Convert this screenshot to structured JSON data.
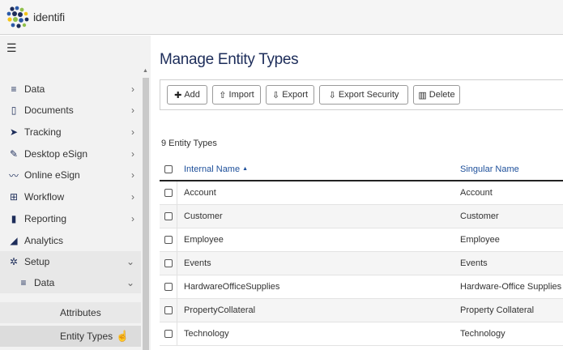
{
  "app": {
    "logo_text": "identifi"
  },
  "sidebar": {
    "items": [
      {
        "label": "Data",
        "icon": "database-icon",
        "chevron": ">"
      },
      {
        "label": "Documents",
        "icon": "document-icon",
        "chevron": ">"
      },
      {
        "label": "Tracking",
        "icon": "location-arrow-icon",
        "chevron": ">"
      },
      {
        "label": "Desktop eSign",
        "icon": "pen-icon",
        "chevron": ">"
      },
      {
        "label": "Online eSign",
        "icon": "signature-icon",
        "chevron": ">"
      },
      {
        "label": "Workflow",
        "icon": "sitemap-icon",
        "chevron": ">"
      },
      {
        "label": "Reporting",
        "icon": "report-icon",
        "chevron": ">"
      },
      {
        "label": "Analytics",
        "icon": "area-chart-icon"
      },
      {
        "label": "Setup",
        "icon": "gear-icon",
        "chevron": "v"
      }
    ],
    "setup_data": {
      "label": "Data",
      "icon": "database-icon",
      "chevron": "v"
    },
    "setup_data_children": [
      {
        "label": "Attributes"
      },
      {
        "label": "Entity Types"
      }
    ]
  },
  "main": {
    "title": "Manage Entity Types",
    "toolbar": {
      "add": "Add",
      "import": "Import",
      "export": "Export",
      "export_security": "Export Security",
      "delete": "Delete"
    },
    "count_text": "9 Entity Types",
    "columns": {
      "internal_name": "Internal Name",
      "sort_indicator": "▲",
      "singular_name": "Singular Name"
    },
    "rows": [
      {
        "internal": "Account",
        "singular": "Account"
      },
      {
        "internal": "Customer",
        "singular": "Customer"
      },
      {
        "internal": "Employee",
        "singular": "Employee"
      },
      {
        "internal": "Events",
        "singular": "Events"
      },
      {
        "internal": "HardwareOfficeSupplies",
        "singular": "Hardware-Office Supplies"
      },
      {
        "internal": "PropertyCollateral",
        "singular": "Property Collateral"
      },
      {
        "internal": "Technology",
        "singular": "Technology"
      }
    ]
  },
  "colors": {
    "brand_navy": "#1d2d5a",
    "link_blue": "#1d4f9a"
  }
}
